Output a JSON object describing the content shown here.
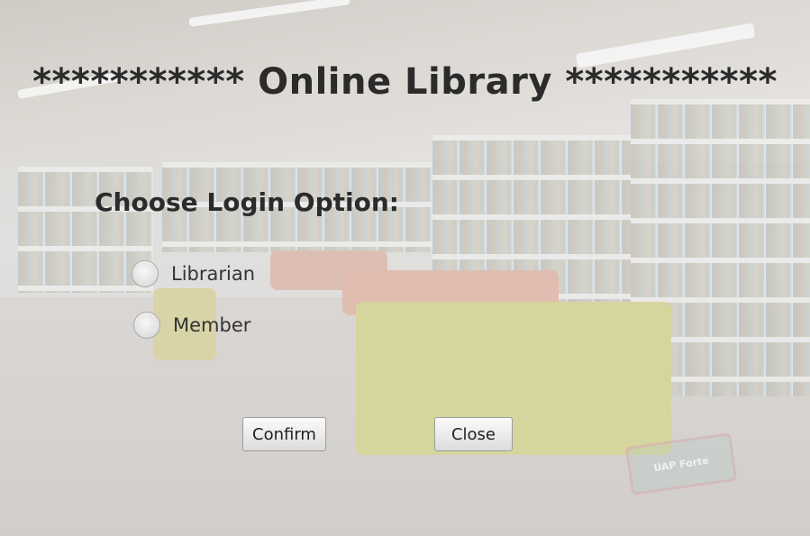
{
  "window": {
    "title": "*********** Online Library ***********"
  },
  "login": {
    "prompt": "Choose Login Option:",
    "options": [
      {
        "label": "Librarian",
        "selected": false
      },
      {
        "label": "Member",
        "selected": false
      }
    ]
  },
  "buttons": {
    "confirm_label": "Confirm",
    "close_label": "Close"
  },
  "background": {
    "watermark_text": "UAP Forte"
  },
  "colors": {
    "title_text": "#2b2b2b",
    "overlay": "rgba(235,235,235,0.45)"
  }
}
